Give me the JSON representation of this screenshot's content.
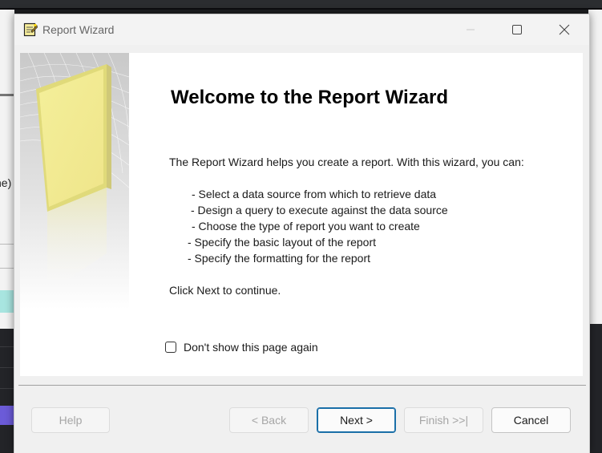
{
  "window": {
    "title": "Report Wizard",
    "controls": [
      "minimize-icon",
      "maximize-icon",
      "close-icon"
    ]
  },
  "background": {
    "partial_text": "ne)"
  },
  "welcome": {
    "heading": "Welcome to the Report Wizard",
    "intro": "The Report Wizard helps you create a report. With this wizard, you can:",
    "bullets": [
      "- Select a data source from which to retrieve data",
      "- Design a query to execute against the data source",
      "- Choose the type of report you want to create",
      "- Specify the basic layout of the report",
      "- Specify the formatting for the report"
    ],
    "outro": "Click Next to continue."
  },
  "options": {
    "dont_show_label": "Don't show this page again",
    "dont_show_checked": false
  },
  "buttons": {
    "help": "Help",
    "back": "< Back",
    "next": "Next >",
    "finish": "Finish >>|",
    "cancel": "Cancel"
  },
  "colors": {
    "dialog_bg": "#f0f0f0",
    "content_bg": "#ffffff",
    "default_button_border": "#1a6fa8",
    "disabled_text": "#a6a6a6"
  }
}
